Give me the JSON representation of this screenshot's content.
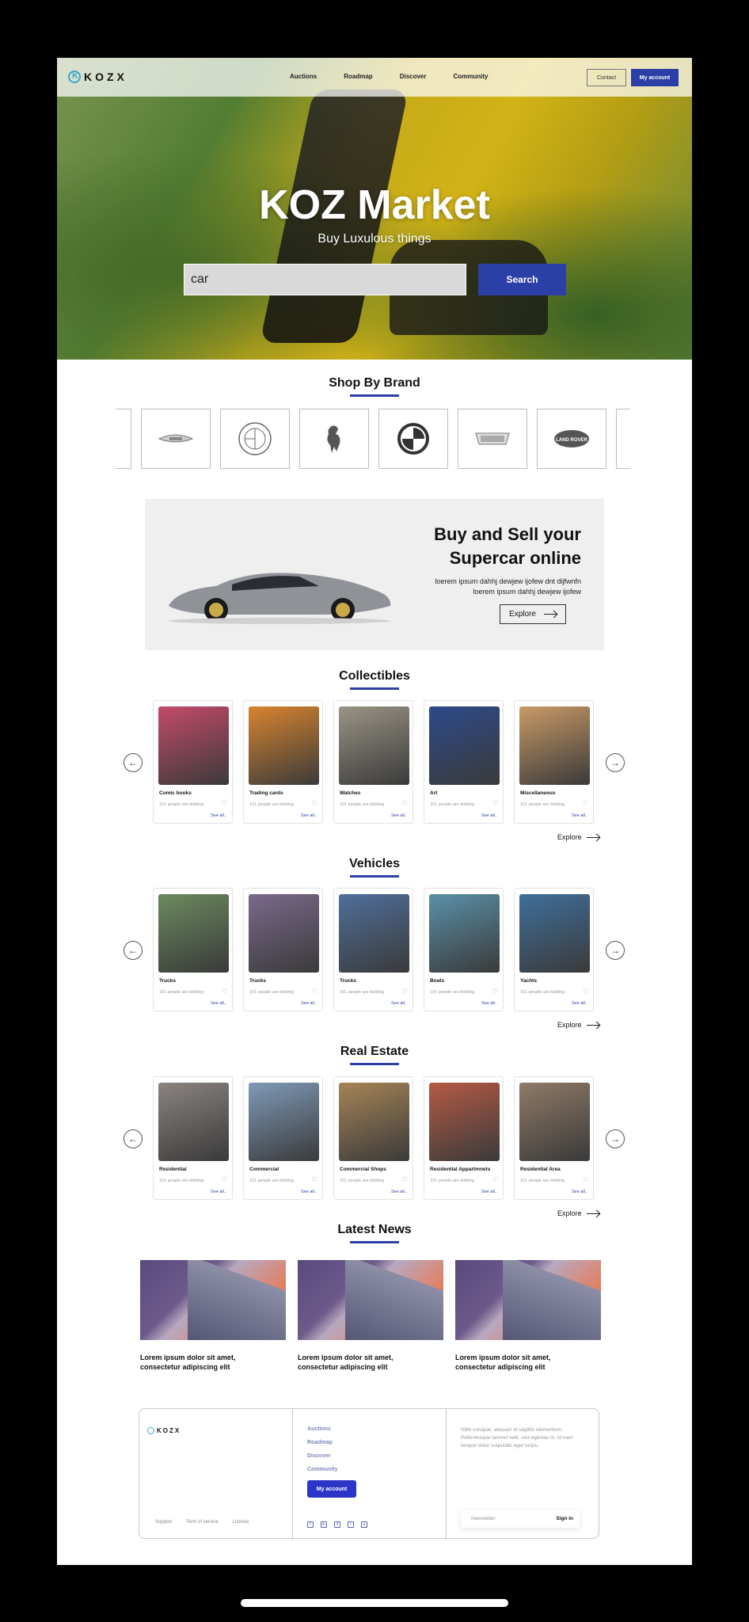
{
  "header": {
    "logo": "KOZX",
    "nav": [
      "Auctions",
      "Roadmap",
      "Discover",
      "Community"
    ],
    "contact": "Contact",
    "account": "My account"
  },
  "hero": {
    "title": "KOZ Market",
    "subtitle": "Buy Luxulous things",
    "search_value": "car",
    "search_button": "Search"
  },
  "brands": {
    "title": "Shop By Brand",
    "items": [
      "aston-martin-icon",
      "alfa-romeo-icon",
      "ferrari-icon",
      "bmw-icon",
      "cadillac-icon",
      "land-rover-icon"
    ],
    "land_rover_text": "LAND ROVER"
  },
  "promo": {
    "heading_line1": "Buy and Sell your",
    "heading_line2": "Supercar online",
    "desc_line1": "loerem ipsum dahhj dewjew ijofew dnt dijfwnfn",
    "desc_line2": "loerem ipsum dahhj dewjew ijofew",
    "button": "Explore"
  },
  "collectibles": {
    "title": "Collectibles",
    "explore": "Explore",
    "cards": [
      {
        "title": "Comic books",
        "bid": "101 people are bidding",
        "see": "See all..",
        "color": "#c44a6a"
      },
      {
        "title": "Trading cards",
        "bid": "101 people are bidding",
        "see": "See all..",
        "color": "#d8842f"
      },
      {
        "title": "Watches",
        "bid": "101 people are bidding",
        "see": "See all..",
        "color": "#9a9486"
      },
      {
        "title": "Art",
        "bid": "101 people are bidding",
        "see": "See all..",
        "color": "#2d4a8a"
      },
      {
        "title": "Miscellaneous",
        "bid": "101 people are bidding",
        "see": "See all..",
        "color": "#c99a66"
      }
    ]
  },
  "vehicles": {
    "title": "Vehicles",
    "explore": "Explore",
    "cards": [
      {
        "title": "Trucks",
        "bid": "101 people are bidding",
        "see": "See all..",
        "color": "#6b8a5e"
      },
      {
        "title": "Trucks",
        "bid": "101 people are bidding",
        "see": "See all..",
        "color": "#7a6a8c"
      },
      {
        "title": "Trucks",
        "bid": "101 people are bidding",
        "see": "See all..",
        "color": "#4f6f9a"
      },
      {
        "title": "Boats",
        "bid": "101 people are bidding",
        "see": "See all..",
        "color": "#5a90a8"
      },
      {
        "title": "Yachts",
        "bid": "101 people are bidding",
        "see": "See all..",
        "color": "#3f6f9a"
      }
    ]
  },
  "realestate": {
    "title": "Real Estate",
    "explore": "Explore",
    "cards": [
      {
        "title": "Residential",
        "bid": "101 people are bidding",
        "see": "See all..",
        "color": "#8a8480"
      },
      {
        "title": "Commercial",
        "bid": "101 people are bidding",
        "see": "See all..",
        "color": "#7f9ab8"
      },
      {
        "title": "Commercial Shops",
        "bid": "101 people are bidding",
        "see": "See all..",
        "color": "#a68456"
      },
      {
        "title": "Residential Appartmnets",
        "bid": "101 people are bidding",
        "see": "See all..",
        "color": "#b45a45"
      },
      {
        "title": "Residential Area",
        "bid": "101 people are bidding",
        "see": "See all..",
        "color": "#8f7a66"
      }
    ]
  },
  "news": {
    "title": "Latest News",
    "items": [
      {
        "line1": "Lorem ipsum dolor sit amet,",
        "line2": "consectetur adipiscing elit"
      },
      {
        "line1": "Lorem ipsum dolor sit amet,",
        "line2": "consectetur adipiscing elit"
      },
      {
        "line1": "Lorem ipsum dolor sit amet,",
        "line2": "consectetur adipiscing elit"
      }
    ]
  },
  "footer": {
    "logo": "KOZX",
    "links": [
      "Support",
      "Term of service",
      "License"
    ],
    "nav": [
      "Auctions",
      "Roadmap",
      "Discover",
      "Community"
    ],
    "account": "My account",
    "text": "Nibh volutpat, aliquam id sagittis elementum. Pellentesque laoreet velit, sed egestas in. Id nam tempor dolor vulputate eget turpis.",
    "newsletter_placeholder": "Newsletter",
    "sign_in": "Sign in"
  }
}
